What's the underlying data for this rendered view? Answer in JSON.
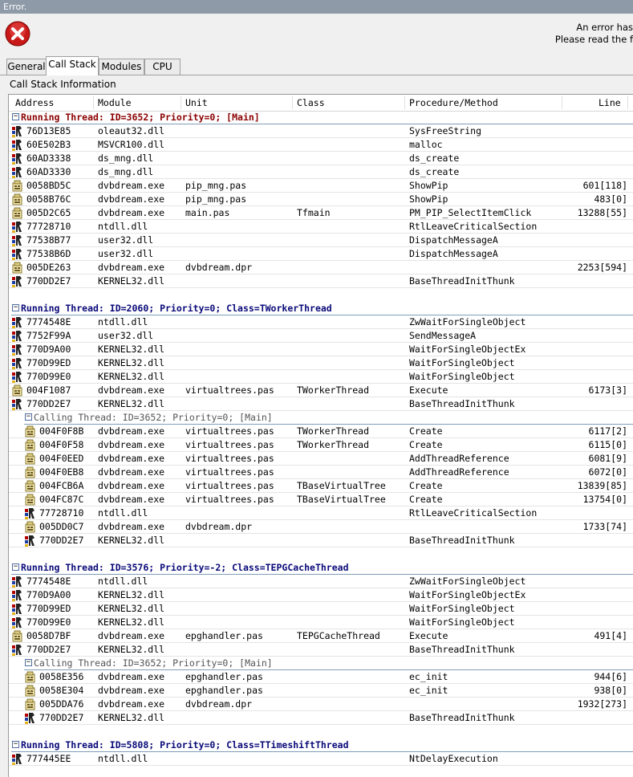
{
  "window": {
    "title": "Error."
  },
  "error": {
    "icon": "error-icon",
    "line1": "An error has",
    "line2": "Please read the f"
  },
  "tabs": [
    {
      "label": "General",
      "active": false
    },
    {
      "label": "Call Stack",
      "active": true
    },
    {
      "label": "Modules",
      "active": false
    },
    {
      "label": "CPU",
      "active": false
    }
  ],
  "call_stack": {
    "section_label": "Call Stack Information",
    "columns": [
      "Address",
      "Module",
      "Unit",
      "Class",
      "Procedure/Method",
      "Line"
    ],
    "rows": [
      {
        "kind": "thread",
        "level": 0,
        "main": true,
        "text": "Running Thread: ID=3652; Priority=0; [Main]"
      },
      {
        "kind": "frame",
        "level": 0,
        "icon": "sys",
        "address": "76D13E85",
        "module": "oleaut32.dll",
        "unit": "",
        "class": "",
        "procedure": "SysFreeString",
        "line": ""
      },
      {
        "kind": "frame",
        "level": 0,
        "icon": "sys",
        "address": "60E502B3",
        "module": "MSVCR100.dll",
        "unit": "",
        "class": "",
        "procedure": "malloc",
        "line": ""
      },
      {
        "kind": "frame",
        "level": 0,
        "icon": "sys",
        "address": "60AD3338",
        "module": "ds_mng.dll",
        "unit": "",
        "class": "",
        "procedure": "ds_create",
        "line": ""
      },
      {
        "kind": "frame",
        "level": 0,
        "icon": "sys",
        "address": "60AD3330",
        "module": "ds_mng.dll",
        "unit": "",
        "class": "",
        "procedure": "ds_create",
        "line": ""
      },
      {
        "kind": "frame",
        "level": 0,
        "icon": "app",
        "address": "0058BD5C",
        "module": "dvbdream.exe",
        "unit": "pip_mng.pas",
        "class": "",
        "procedure": "ShowPip",
        "line": "601[118]"
      },
      {
        "kind": "frame",
        "level": 0,
        "icon": "app",
        "address": "0058B76C",
        "module": "dvbdream.exe",
        "unit": "pip_mng.pas",
        "class": "",
        "procedure": "ShowPip",
        "line": "483[0]"
      },
      {
        "kind": "frame",
        "level": 0,
        "icon": "app",
        "address": "005D2C65",
        "module": "dvbdream.exe",
        "unit": "main.pas",
        "class": "Tfmain",
        "procedure": "PM_PIP_SelectItemClick",
        "line": "13288[55]"
      },
      {
        "kind": "frame",
        "level": 0,
        "icon": "sys",
        "address": "77728710",
        "module": "ntdll.dll",
        "unit": "",
        "class": "",
        "procedure": "RtlLeaveCriticalSection",
        "line": ""
      },
      {
        "kind": "frame",
        "level": 0,
        "icon": "sys",
        "address": "77538B77",
        "module": "user32.dll",
        "unit": "",
        "class": "",
        "procedure": "DispatchMessageA",
        "line": ""
      },
      {
        "kind": "frame",
        "level": 0,
        "icon": "sys",
        "address": "77538B6D",
        "module": "user32.dll",
        "unit": "",
        "class": "",
        "procedure": "DispatchMessageA",
        "line": ""
      },
      {
        "kind": "frame",
        "level": 0,
        "icon": "app",
        "address": "005DE263",
        "module": "dvbdream.exe",
        "unit": "dvbdream.dpr",
        "class": "",
        "procedure": "",
        "line": "2253[594]"
      },
      {
        "kind": "frame",
        "level": 0,
        "icon": "sys",
        "address": "770DD2E7",
        "module": "KERNEL32.dll",
        "unit": "",
        "class": "",
        "procedure": "BaseThreadInitThunk",
        "line": ""
      },
      {
        "kind": "blank"
      },
      {
        "kind": "thread",
        "level": 0,
        "main": false,
        "text": "Running Thread: ID=2060; Priority=0; Class=TWorkerThread"
      },
      {
        "kind": "frame",
        "level": 0,
        "icon": "sys",
        "address": "7774548E",
        "module": "ntdll.dll",
        "unit": "",
        "class": "",
        "procedure": "ZwWaitForSingleObject",
        "line": ""
      },
      {
        "kind": "frame",
        "level": 0,
        "icon": "sys",
        "address": "7752F99A",
        "module": "user32.dll",
        "unit": "",
        "class": "",
        "procedure": "SendMessageA",
        "line": ""
      },
      {
        "kind": "frame",
        "level": 0,
        "icon": "sys",
        "address": "770D9A00",
        "module": "KERNEL32.dll",
        "unit": "",
        "class": "",
        "procedure": "WaitForSingleObjectEx",
        "line": ""
      },
      {
        "kind": "frame",
        "level": 0,
        "icon": "sys",
        "address": "770D99ED",
        "module": "KERNEL32.dll",
        "unit": "",
        "class": "",
        "procedure": "WaitForSingleObject",
        "line": ""
      },
      {
        "kind": "frame",
        "level": 0,
        "icon": "sys",
        "address": "770D99E0",
        "module": "KERNEL32.dll",
        "unit": "",
        "class": "",
        "procedure": "WaitForSingleObject",
        "line": ""
      },
      {
        "kind": "frame",
        "level": 0,
        "icon": "app",
        "address": "004F1087",
        "module": "dvbdream.exe",
        "unit": "virtualtrees.pas",
        "class": "TWorkerThread",
        "procedure": "Execute",
        "line": "6173[3]"
      },
      {
        "kind": "frame",
        "level": 0,
        "icon": "sys",
        "address": "770DD2E7",
        "module": "KERNEL32.dll",
        "unit": "",
        "class": "",
        "procedure": "BaseThreadInitThunk",
        "line": ""
      },
      {
        "kind": "thread",
        "level": 1,
        "calling": true,
        "text": "Calling Thread: ID=3652; Priority=0; [Main]"
      },
      {
        "kind": "frame",
        "level": 1,
        "icon": "app",
        "address": "004F0F8B",
        "module": "dvbdream.exe",
        "unit": "virtualtrees.pas",
        "class": "TWorkerThread",
        "procedure": "Create",
        "line": "6117[2]"
      },
      {
        "kind": "frame",
        "level": 1,
        "icon": "app",
        "address": "004F0F58",
        "module": "dvbdream.exe",
        "unit": "virtualtrees.pas",
        "class": "TWorkerThread",
        "procedure": "Create",
        "line": "6115[0]"
      },
      {
        "kind": "frame",
        "level": 1,
        "icon": "app",
        "address": "004F0EED",
        "module": "dvbdream.exe",
        "unit": "virtualtrees.pas",
        "class": "",
        "procedure": "AddThreadReference",
        "line": "6081[9]"
      },
      {
        "kind": "frame",
        "level": 1,
        "icon": "app",
        "address": "004F0EB8",
        "module": "dvbdream.exe",
        "unit": "virtualtrees.pas",
        "class": "",
        "procedure": "AddThreadReference",
        "line": "6072[0]"
      },
      {
        "kind": "frame",
        "level": 1,
        "icon": "app",
        "address": "004FCB6A",
        "module": "dvbdream.exe",
        "unit": "virtualtrees.pas",
        "class": "TBaseVirtualTree",
        "procedure": "Create",
        "line": "13839[85]"
      },
      {
        "kind": "frame",
        "level": 1,
        "icon": "app",
        "address": "004FC87C",
        "module": "dvbdream.exe",
        "unit": "virtualtrees.pas",
        "class": "TBaseVirtualTree",
        "procedure": "Create",
        "line": "13754[0]"
      },
      {
        "kind": "frame",
        "level": 1,
        "icon": "sys",
        "address": "77728710",
        "module": "ntdll.dll",
        "unit": "",
        "class": "",
        "procedure": "RtlLeaveCriticalSection",
        "line": ""
      },
      {
        "kind": "frame",
        "level": 1,
        "icon": "app",
        "address": "005DD0C7",
        "module": "dvbdream.exe",
        "unit": "dvbdream.dpr",
        "class": "",
        "procedure": "",
        "line": "1733[74]"
      },
      {
        "kind": "frame",
        "level": 1,
        "icon": "sys",
        "address": "770DD2E7",
        "module": "KERNEL32.dll",
        "unit": "",
        "class": "",
        "procedure": "BaseThreadInitThunk",
        "line": ""
      },
      {
        "kind": "blank"
      },
      {
        "kind": "thread",
        "level": 0,
        "main": false,
        "text": "Running Thread: ID=3576; Priority=-2; Class=TEPGCacheThread"
      },
      {
        "kind": "frame",
        "level": 0,
        "icon": "sys",
        "address": "7774548E",
        "module": "ntdll.dll",
        "unit": "",
        "class": "",
        "procedure": "ZwWaitForSingleObject",
        "line": ""
      },
      {
        "kind": "frame",
        "level": 0,
        "icon": "sys",
        "address": "770D9A00",
        "module": "KERNEL32.dll",
        "unit": "",
        "class": "",
        "procedure": "WaitForSingleObjectEx",
        "line": ""
      },
      {
        "kind": "frame",
        "level": 0,
        "icon": "sys",
        "address": "770D99ED",
        "module": "KERNEL32.dll",
        "unit": "",
        "class": "",
        "procedure": "WaitForSingleObject",
        "line": ""
      },
      {
        "kind": "frame",
        "level": 0,
        "icon": "sys",
        "address": "770D99E0",
        "module": "KERNEL32.dll",
        "unit": "",
        "class": "",
        "procedure": "WaitForSingleObject",
        "line": ""
      },
      {
        "kind": "frame",
        "level": 0,
        "icon": "app",
        "address": "0058D7BF",
        "module": "dvbdream.exe",
        "unit": "epghandler.pas",
        "class": "TEPGCacheThread",
        "procedure": "Execute",
        "line": "491[4]"
      },
      {
        "kind": "frame",
        "level": 0,
        "icon": "sys",
        "address": "770DD2E7",
        "module": "KERNEL32.dll",
        "unit": "",
        "class": "",
        "procedure": "BaseThreadInitThunk",
        "line": ""
      },
      {
        "kind": "thread",
        "level": 1,
        "calling": true,
        "text": "Calling Thread: ID=3652; Priority=0; [Main]"
      },
      {
        "kind": "frame",
        "level": 1,
        "icon": "app",
        "address": "0058E356",
        "module": "dvbdream.exe",
        "unit": "epghandler.pas",
        "class": "",
        "procedure": "ec_init",
        "line": "944[6]"
      },
      {
        "kind": "frame",
        "level": 1,
        "icon": "app",
        "address": "0058E304",
        "module": "dvbdream.exe",
        "unit": "epghandler.pas",
        "class": "",
        "procedure": "ec_init",
        "line": "938[0]"
      },
      {
        "kind": "frame",
        "level": 1,
        "icon": "app",
        "address": "005DDA76",
        "module": "dvbdream.exe",
        "unit": "dvbdream.dpr",
        "class": "",
        "procedure": "",
        "line": "1932[273]"
      },
      {
        "kind": "frame",
        "level": 1,
        "icon": "sys",
        "address": "770DD2E7",
        "module": "KERNEL32.dll",
        "unit": "",
        "class": "",
        "procedure": "BaseThreadInitThunk",
        "line": ""
      },
      {
        "kind": "blank"
      },
      {
        "kind": "thread",
        "level": 0,
        "main": false,
        "text": "Running Thread: ID=5808; Priority=0; Class=TTimeshiftThread"
      },
      {
        "kind": "frame",
        "level": 0,
        "icon": "sys",
        "address": "777445EE",
        "module": "ntdll.dll",
        "unit": "",
        "class": "",
        "procedure": "NtDelayExecution",
        "line": ""
      }
    ]
  },
  "colors": {
    "main_thread": "#8b0000",
    "thread": "#0a0a7a",
    "calling_thread": "#555555",
    "icon_red": "#b00000",
    "icon_blue": "#1e3fa0",
    "icon_yellow": "#e3b21a"
  }
}
